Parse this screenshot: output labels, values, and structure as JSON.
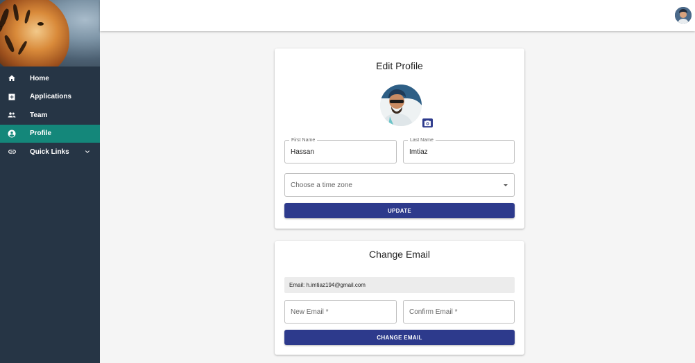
{
  "sidebar": {
    "items": [
      {
        "label": "Home",
        "icon": "home-icon"
      },
      {
        "label": "Applications",
        "icon": "applications-icon"
      },
      {
        "label": "Team",
        "icon": "team-icon"
      },
      {
        "label": "Profile",
        "icon": "profile-icon",
        "active": true
      },
      {
        "label": "Quick Links",
        "icon": "link-icon",
        "expandable": true
      }
    ],
    "bg_color": "#263545",
    "active_color": "#14877a"
  },
  "edit_profile": {
    "title": "Edit Profile",
    "first_name_label": "First Name",
    "first_name_value": "Hassan",
    "last_name_label": "Last Name",
    "last_name_value": "Imtiaz",
    "timezone_placeholder": "Choose a time zone",
    "update_label": "UPDATE"
  },
  "change_email": {
    "title": "Change Email",
    "current_email": "Email: h.imtiaz194@gmail.com",
    "new_email_placeholder": "New Email *",
    "confirm_email_placeholder": "Confirm Email *",
    "button_label": "CHANGE EMAIL"
  },
  "colors": {
    "primary_button": "#2d3a8c"
  }
}
